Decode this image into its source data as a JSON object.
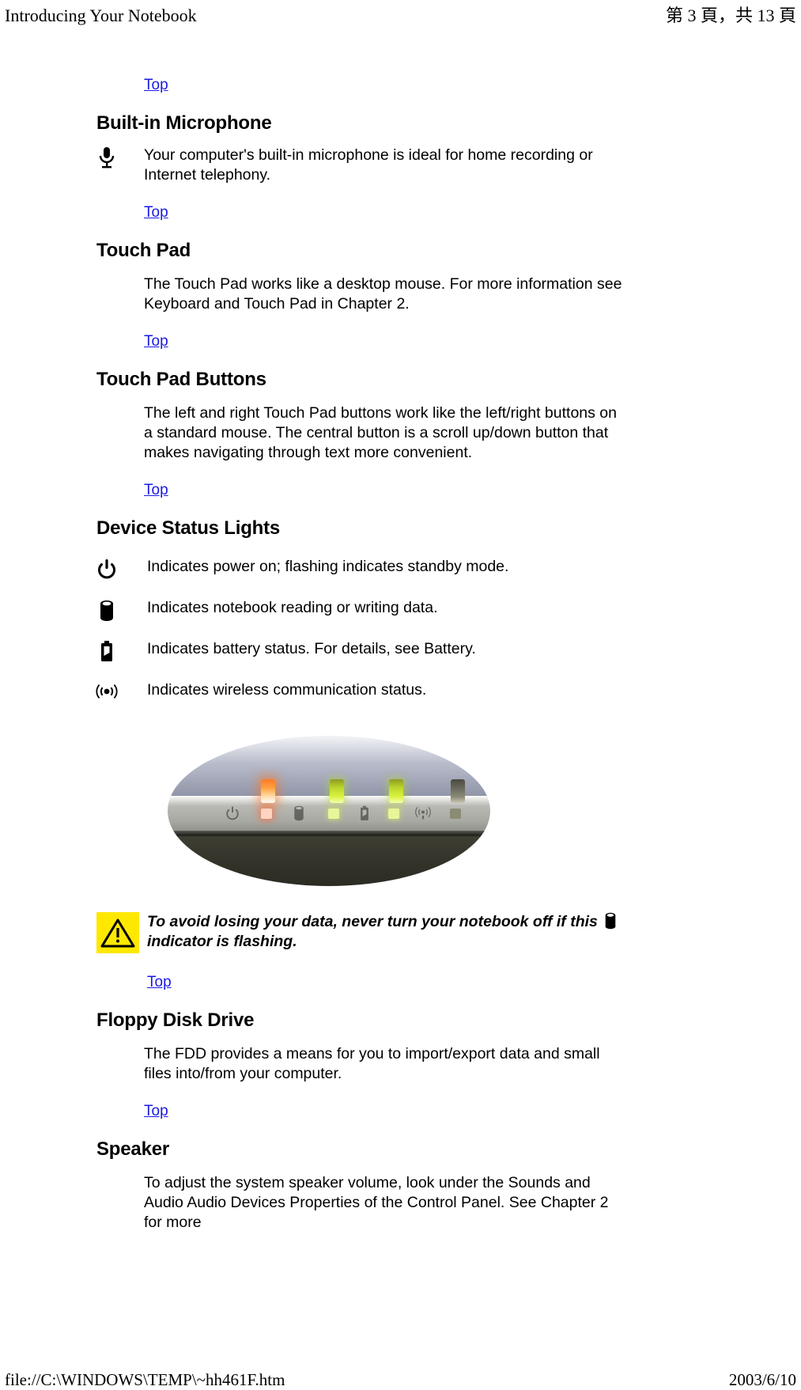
{
  "header": {
    "title": "Introducing Your Notebook",
    "page_indicator": "第 3 頁，共 13 頁"
  },
  "footer": {
    "file_path": "file://C:\\WINDOWS\\TEMP\\~hh461F.htm",
    "date": "2003/6/10"
  },
  "links": {
    "top": "Top"
  },
  "sections": {
    "microphone": {
      "heading": "Built-in Microphone",
      "icon": "microphone-icon",
      "text": "Your computer's built-in microphone is ideal for home recording or Internet telephony."
    },
    "touch_pad": {
      "heading": "Touch Pad",
      "text": "The Touch Pad works like a desktop mouse. For more information see Keyboard and Touch Pad in Chapter 2."
    },
    "touch_pad_buttons": {
      "heading": "Touch Pad Buttons",
      "text": "The left and right Touch Pad buttons work like the left/right buttons on a standard mouse. The central button is a scroll up/down button that makes navigating through text more convenient."
    },
    "device_status_lights": {
      "heading": "Device Status Lights",
      "items": [
        {
          "icon": "power-icon",
          "text": "Indicates power on; flashing indicates standby mode."
        },
        {
          "icon": "disk-icon",
          "text": "Indicates notebook reading or writing data."
        },
        {
          "icon": "battery-icon",
          "text": "Indicates battery status. For details, see Battery."
        },
        {
          "icon": "wireless-icon",
          "text": "Indicates wireless communication status."
        }
      ],
      "photo": {
        "name": "status-lights-photo",
        "leds": [
          "amber",
          "green",
          "green",
          "off"
        ],
        "panel_icons": [
          "power-icon",
          "disk-icon",
          "battery-icon",
          "wireless-icon"
        ]
      },
      "warning": {
        "icon": "warning-triangle-icon",
        "text_before": "To avoid losing your data, never turn your notebook off if this",
        "inline_icon": "disk-icon",
        "text_after": "indicator is flashing."
      }
    },
    "floppy_disk_drive": {
      "heading": "Floppy Disk Drive",
      "text": "The FDD provides a means for you to import/export data and small files into/from your computer."
    },
    "speaker": {
      "heading": "Speaker",
      "text": "To adjust the system speaker volume, look under the Sounds and Audio Audio Devices Properties of the Control Panel. See Chapter 2 for more"
    }
  },
  "colors": {
    "link": "#1a1ae6",
    "warning_background": "#ffe800",
    "text": "#000000"
  }
}
